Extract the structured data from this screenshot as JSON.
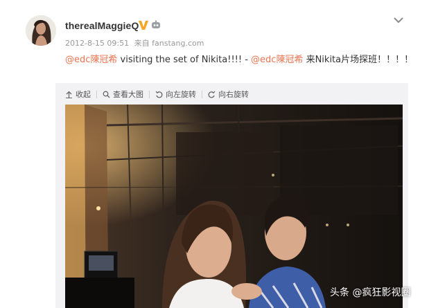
{
  "post": {
    "username": "therealMaggieQ",
    "timestamp": "2012-8-15 09:51",
    "source_prefix": "来自",
    "source": "fanstang.com",
    "mention_1": "@edc陳冠希",
    "text_1": " visiting the set of Nikita!!!! - ",
    "mention_2": "@edc陳冠希",
    "text_2": " 来Nikita片场探班！！！！"
  },
  "toolbar": {
    "collapse": "收起",
    "view_large": "查看大图",
    "rotate_left": "向左旋转",
    "rotate_right": "向右旋转"
  },
  "watermark": "头条 @疯狂影视圈",
  "icons": {
    "verified": "verified-v-badge-icon",
    "member": "weibo-member-icon",
    "menu": "chevron-down-icon",
    "collapse": "collapse-up-icon",
    "view_large": "magnifier-icon",
    "rotate_left": "rotate-left-icon",
    "rotate_right": "rotate-right-icon"
  },
  "colors": {
    "mention": "#eb7350",
    "verified": "#f5a623",
    "meta_text": "#999999",
    "media_bg": "#f2f2f5"
  }
}
